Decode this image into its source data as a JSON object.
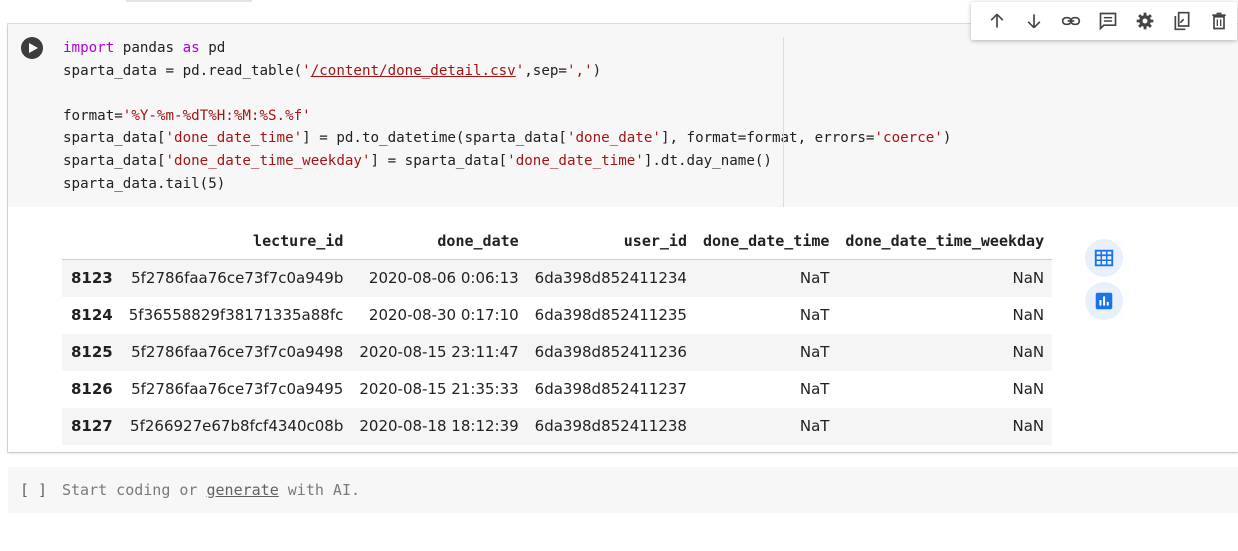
{
  "code_cell": {
    "lines": [
      [
        {
          "t": "import",
          "c": "kw"
        },
        {
          "t": " pandas "
        },
        {
          "t": "as",
          "c": "kw"
        },
        {
          "t": " pd"
        }
      ],
      [
        {
          "t": "sparta_data = pd.read_table("
        },
        {
          "t": "'",
          "c": "str"
        },
        {
          "t": "/content/done_detail.csv",
          "c": "str u"
        },
        {
          "t": "'",
          "c": "str"
        },
        {
          "t": ",sep="
        },
        {
          "t": "','",
          "c": "str"
        },
        {
          "t": ")"
        }
      ],
      [],
      [
        {
          "t": "format="
        },
        {
          "t": "'%Y-%m-%dT%H:%M:%S.%f'",
          "c": "str"
        }
      ],
      [
        {
          "t": "sparta_data["
        },
        {
          "t": "'done_date_time'",
          "c": "str"
        },
        {
          "t": "] = pd.to_datetime(sparta_data["
        },
        {
          "t": "'done_date'",
          "c": "str"
        },
        {
          "t": "], format=format, errors="
        },
        {
          "t": "'coerce'",
          "c": "str"
        },
        {
          "t": ")"
        }
      ],
      [
        {
          "t": "sparta_data["
        },
        {
          "t": "'done_date_time_weekday'",
          "c": "str"
        },
        {
          "t": "] = sparta_data["
        },
        {
          "t": "'done_date_time'",
          "c": "str"
        },
        {
          "t": "].dt.day_name()"
        }
      ],
      [
        {
          "t": "sparta_data.tail(5)"
        }
      ]
    ]
  },
  "toolbar": {
    "buttons": [
      {
        "name": "move-up-button",
        "icon": "arrow-up-icon"
      },
      {
        "name": "move-down-button",
        "icon": "arrow-down-icon"
      },
      {
        "name": "link-button",
        "icon": "link-icon"
      },
      {
        "name": "comment-button",
        "icon": "comment-icon"
      },
      {
        "name": "settings-button",
        "icon": "gear-icon"
      },
      {
        "name": "mirror-cell-button",
        "icon": "mirror-icon"
      },
      {
        "name": "delete-button",
        "icon": "trash-icon"
      }
    ]
  },
  "dataframe": {
    "columns": [
      "",
      "lecture_id",
      "done_date",
      "user_id",
      "done_date_time",
      "done_date_time_weekday"
    ],
    "rows": [
      [
        "8123",
        "5f2786faa76ce73f7c0a949b",
        "2020-08-06 0:06:13",
        "6da398d852411234",
        "NaT",
        "NaN"
      ],
      [
        "8124",
        "5f36558829f38171335a88fc",
        "2020-08-30 0:17:10",
        "6da398d852411235",
        "NaT",
        "NaN"
      ],
      [
        "8125",
        "5f2786faa76ce73f7c0a9498",
        "2020-08-15 23:11:47",
        "6da398d852411236",
        "NaT",
        "NaN"
      ],
      [
        "8126",
        "5f2786faa76ce73f7c0a9495",
        "2020-08-15 21:35:33",
        "6da398d852411237",
        "NaT",
        "NaN"
      ],
      [
        "8127",
        "5f266927e67b8fcf4340c08b",
        "2020-08-18 18:12:39",
        "6da398d852411238",
        "NaT",
        "NaN"
      ]
    ]
  },
  "empty_cell": {
    "bracket": "[ ]",
    "placeholder_prefix": "Start coding or ",
    "placeholder_link": "generate",
    "placeholder_suffix": " with AI."
  },
  "colors": {
    "keyword": "#af00db",
    "string": "#a31515",
    "accent": "#1a73e8"
  }
}
